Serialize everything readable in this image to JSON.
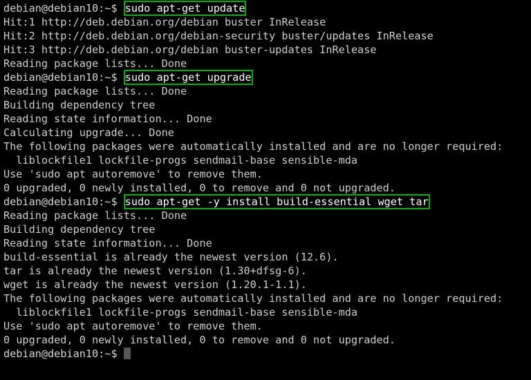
{
  "terminal": {
    "shell_prompt": "debian@debian10:~$ ",
    "background_color": "#000000",
    "text_color": "#cccccc",
    "highlight_color": "#00b500",
    "cursor_color": "#565656",
    "cursor_glyph": " "
  },
  "lines": [
    {
      "type": "command",
      "prompt": "debian@debian10:~$ ",
      "command": "sudo apt-get update",
      "highlighted": true
    },
    {
      "type": "output",
      "text": "Hit:1 http://deb.debian.org/debian buster InRelease"
    },
    {
      "type": "output",
      "text": "Hit:2 http://deb.debian.org/debian-security buster/updates InRelease"
    },
    {
      "type": "output",
      "text": "Hit:3 http://deb.debian.org/debian buster-updates InRelease"
    },
    {
      "type": "output",
      "text": "Reading package lists... Done"
    },
    {
      "type": "command",
      "prompt": "debian@debian10:~$ ",
      "command": "sudo apt-get upgrade",
      "highlighted": true
    },
    {
      "type": "output",
      "text": "Reading package lists... Done"
    },
    {
      "type": "output",
      "text": "Building dependency tree"
    },
    {
      "type": "output",
      "text": "Reading state information... Done"
    },
    {
      "type": "output",
      "text": "Calculating upgrade... Done"
    },
    {
      "type": "output",
      "text": "The following packages were automatically installed and are no longer required:"
    },
    {
      "type": "output",
      "text": "  liblockfile1 lockfile-progs sendmail-base sensible-mda"
    },
    {
      "type": "output",
      "text": "Use 'sudo apt autoremove' to remove them."
    },
    {
      "type": "output",
      "text": "0 upgraded, 0 newly installed, 0 to remove and 0 not upgraded."
    },
    {
      "type": "command",
      "prompt": "debian@debian10:~$ ",
      "command": "sudo apt-get -y install build-essential wget tar",
      "highlighted": true
    },
    {
      "type": "output",
      "text": "Reading package lists... Done"
    },
    {
      "type": "output",
      "text": "Building dependency tree"
    },
    {
      "type": "output",
      "text": "Reading state information... Done"
    },
    {
      "type": "output",
      "text": "build-essential is already the newest version (12.6)."
    },
    {
      "type": "output",
      "text": "tar is already the newest version (1.30+dfsg-6)."
    },
    {
      "type": "output",
      "text": "wget is already the newest version (1.20.1-1.1)."
    },
    {
      "type": "output",
      "text": "The following packages were automatically installed and are no longer required:"
    },
    {
      "type": "output",
      "text": "  liblockfile1 lockfile-progs sendmail-base sensible-mda"
    },
    {
      "type": "output",
      "text": "Use 'sudo apt autoremove' to remove them."
    },
    {
      "type": "output",
      "text": "0 upgraded, 0 newly installed, 0 to remove and 0 not upgraded."
    },
    {
      "type": "prompt-cursor",
      "prompt": "debian@debian10:~$ "
    }
  ]
}
